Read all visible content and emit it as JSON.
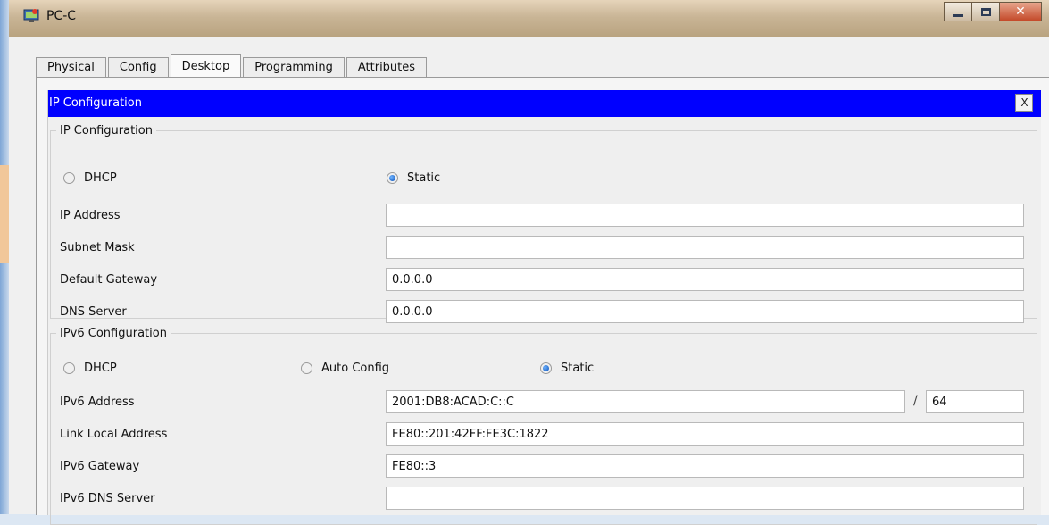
{
  "window": {
    "title": "PC-C"
  },
  "tabs": [
    "Physical",
    "Config",
    "Desktop",
    "Programming",
    "Attributes"
  ],
  "active_tab": "Desktop",
  "panel": {
    "title": "IP Configuration",
    "close_label": "X"
  },
  "ipv4": {
    "legend": "IP Configuration",
    "dhcp_label": "DHCP",
    "static_label": "Static",
    "mode": "Static",
    "ip_address": {
      "label": "IP Address",
      "value": ""
    },
    "subnet_mask": {
      "label": "Subnet Mask",
      "value": ""
    },
    "default_gateway": {
      "label": "Default Gateway",
      "value": "0.0.0.0"
    },
    "dns_server": {
      "label": "DNS Server",
      "value": "0.0.0.0"
    }
  },
  "ipv6": {
    "legend": "IPv6 Configuration",
    "dhcp_label": "DHCP",
    "auto_label": "Auto Config",
    "static_label": "Static",
    "mode": "Static",
    "address": {
      "label": "IPv6 Address",
      "value": "2001:DB8:ACAD:C::C"
    },
    "prefix_separator": "/",
    "prefix_length": "64",
    "link_local": {
      "label": "Link Local Address",
      "value": "FE80::201:42FF:FE3C:1822"
    },
    "gateway": {
      "label": "IPv6 Gateway",
      "value": "FE80::3"
    },
    "dns_server": {
      "label": "IPv6 DNS Server",
      "value": ""
    }
  },
  "colors": {
    "panel_header": "#0000ff",
    "titlebar": "#c9b596"
  },
  "icons": {
    "app": "packet-tracer-pc-icon",
    "minimize": "minimize-icon",
    "maximize": "maximize-icon",
    "close": "close-icon"
  }
}
